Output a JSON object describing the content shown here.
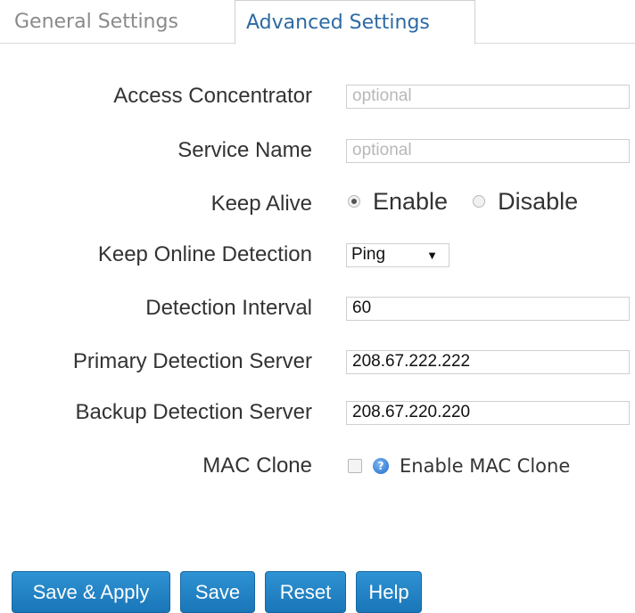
{
  "tabs": {
    "general": "General Settings",
    "advanced": "Advanced Settings"
  },
  "form": {
    "access_concentrator": {
      "label": "Access Concentrator",
      "value": "",
      "placeholder": "optional"
    },
    "service_name": {
      "label": "Service Name",
      "value": "",
      "placeholder": "optional"
    },
    "keep_alive": {
      "label": "Keep Alive",
      "options": [
        {
          "label": "Enable",
          "selected": true
        },
        {
          "label": "Disable",
          "selected": false
        }
      ]
    },
    "keep_online_detection": {
      "label": "Keep Online Detection",
      "selected": "Ping"
    },
    "detection_interval": {
      "label": "Detection Interval",
      "value": "60"
    },
    "primary_detection_server": {
      "label": "Primary Detection Server",
      "value": "208.67.222.222"
    },
    "backup_detection_server": {
      "label": "Backup Detection Server",
      "value": "208.67.220.220"
    },
    "mac_clone": {
      "label": "MAC Clone",
      "checkbox_label": "Enable MAC Clone",
      "checked": false,
      "help_glyph": "?"
    }
  },
  "buttons": {
    "save_apply": "Save & Apply",
    "save": "Save",
    "reset": "Reset",
    "help": "Help"
  },
  "icons": {
    "dropdown": "chevron-down-icon",
    "help": "help-icon"
  },
  "colors": {
    "active_tab": "#2c6aa3",
    "inactive_tab": "#8a8a8a",
    "button": "#1f80c4",
    "help_icon": "#1e6bd0"
  }
}
